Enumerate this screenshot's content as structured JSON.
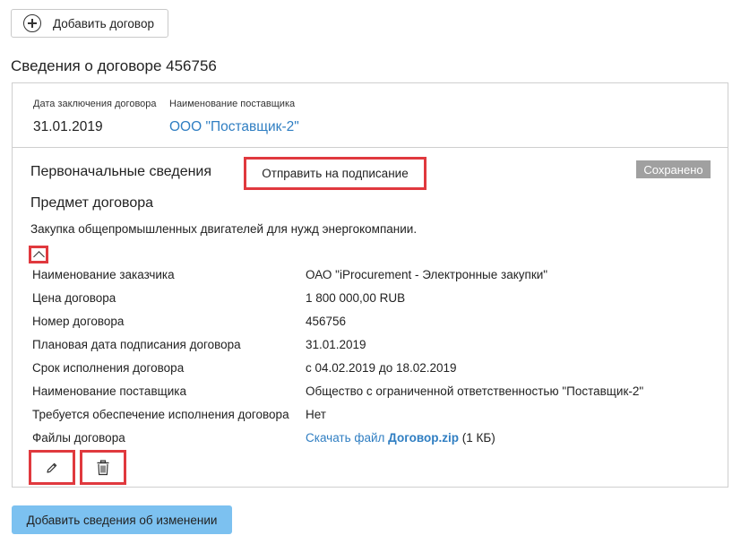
{
  "toolbar": {
    "add_contract_label": "Добавить договор"
  },
  "contract": {
    "title": "Сведения о договоре 456756"
  },
  "summary": {
    "date_label": "Дата заключения договора",
    "date_value": "31.01.2019",
    "supplier_label": "Наименование поставщика",
    "supplier_value": "ООО \"Поставщик-2\""
  },
  "section": {
    "title": "Первоначальные сведения",
    "send_label": "Отправить на подписание",
    "status_badge": "Сохранено",
    "subject_title": "Предмет договора",
    "subject_text": "Закупка общепромышленных двигателей для нужд энергокомпании."
  },
  "details": [
    {
      "key": "Наименование заказчика",
      "value": "ОАО \"iProcurement - Электронные закупки\""
    },
    {
      "key": "Цена договора",
      "value": "1 800 000,00 RUB"
    },
    {
      "key": "Номер договора",
      "value": "456756"
    },
    {
      "key": "Плановая дата подписания договора",
      "value": "31.01.2019"
    },
    {
      "key": "Срок исполнения договора",
      "value": "с 04.02.2019 до 18.02.2019"
    },
    {
      "key": "Наименование поставщика",
      "value": "Общество с ограниченной ответственностью \"Поставщик-2\""
    },
    {
      "key": "Требуется обеспечение исполнения договора",
      "value": "Нет"
    }
  ],
  "files": {
    "label": "Файлы договора",
    "link_prefix": "Скачать файл ",
    "file_name": "Договор.zip",
    "size": " (1 КБ)"
  },
  "icons": {
    "add": "plus-circle-icon",
    "collapse": "chevron-up-icon",
    "edit": "pencil-icon",
    "delete": "trash-icon"
  },
  "colors": {
    "link": "#2f7ec2",
    "highlight": "#e0393e",
    "badge": "#a0a0a0",
    "primary_button": "#7cc1f0"
  },
  "footer": {
    "add_change_label": "Добавить сведения об изменении"
  }
}
